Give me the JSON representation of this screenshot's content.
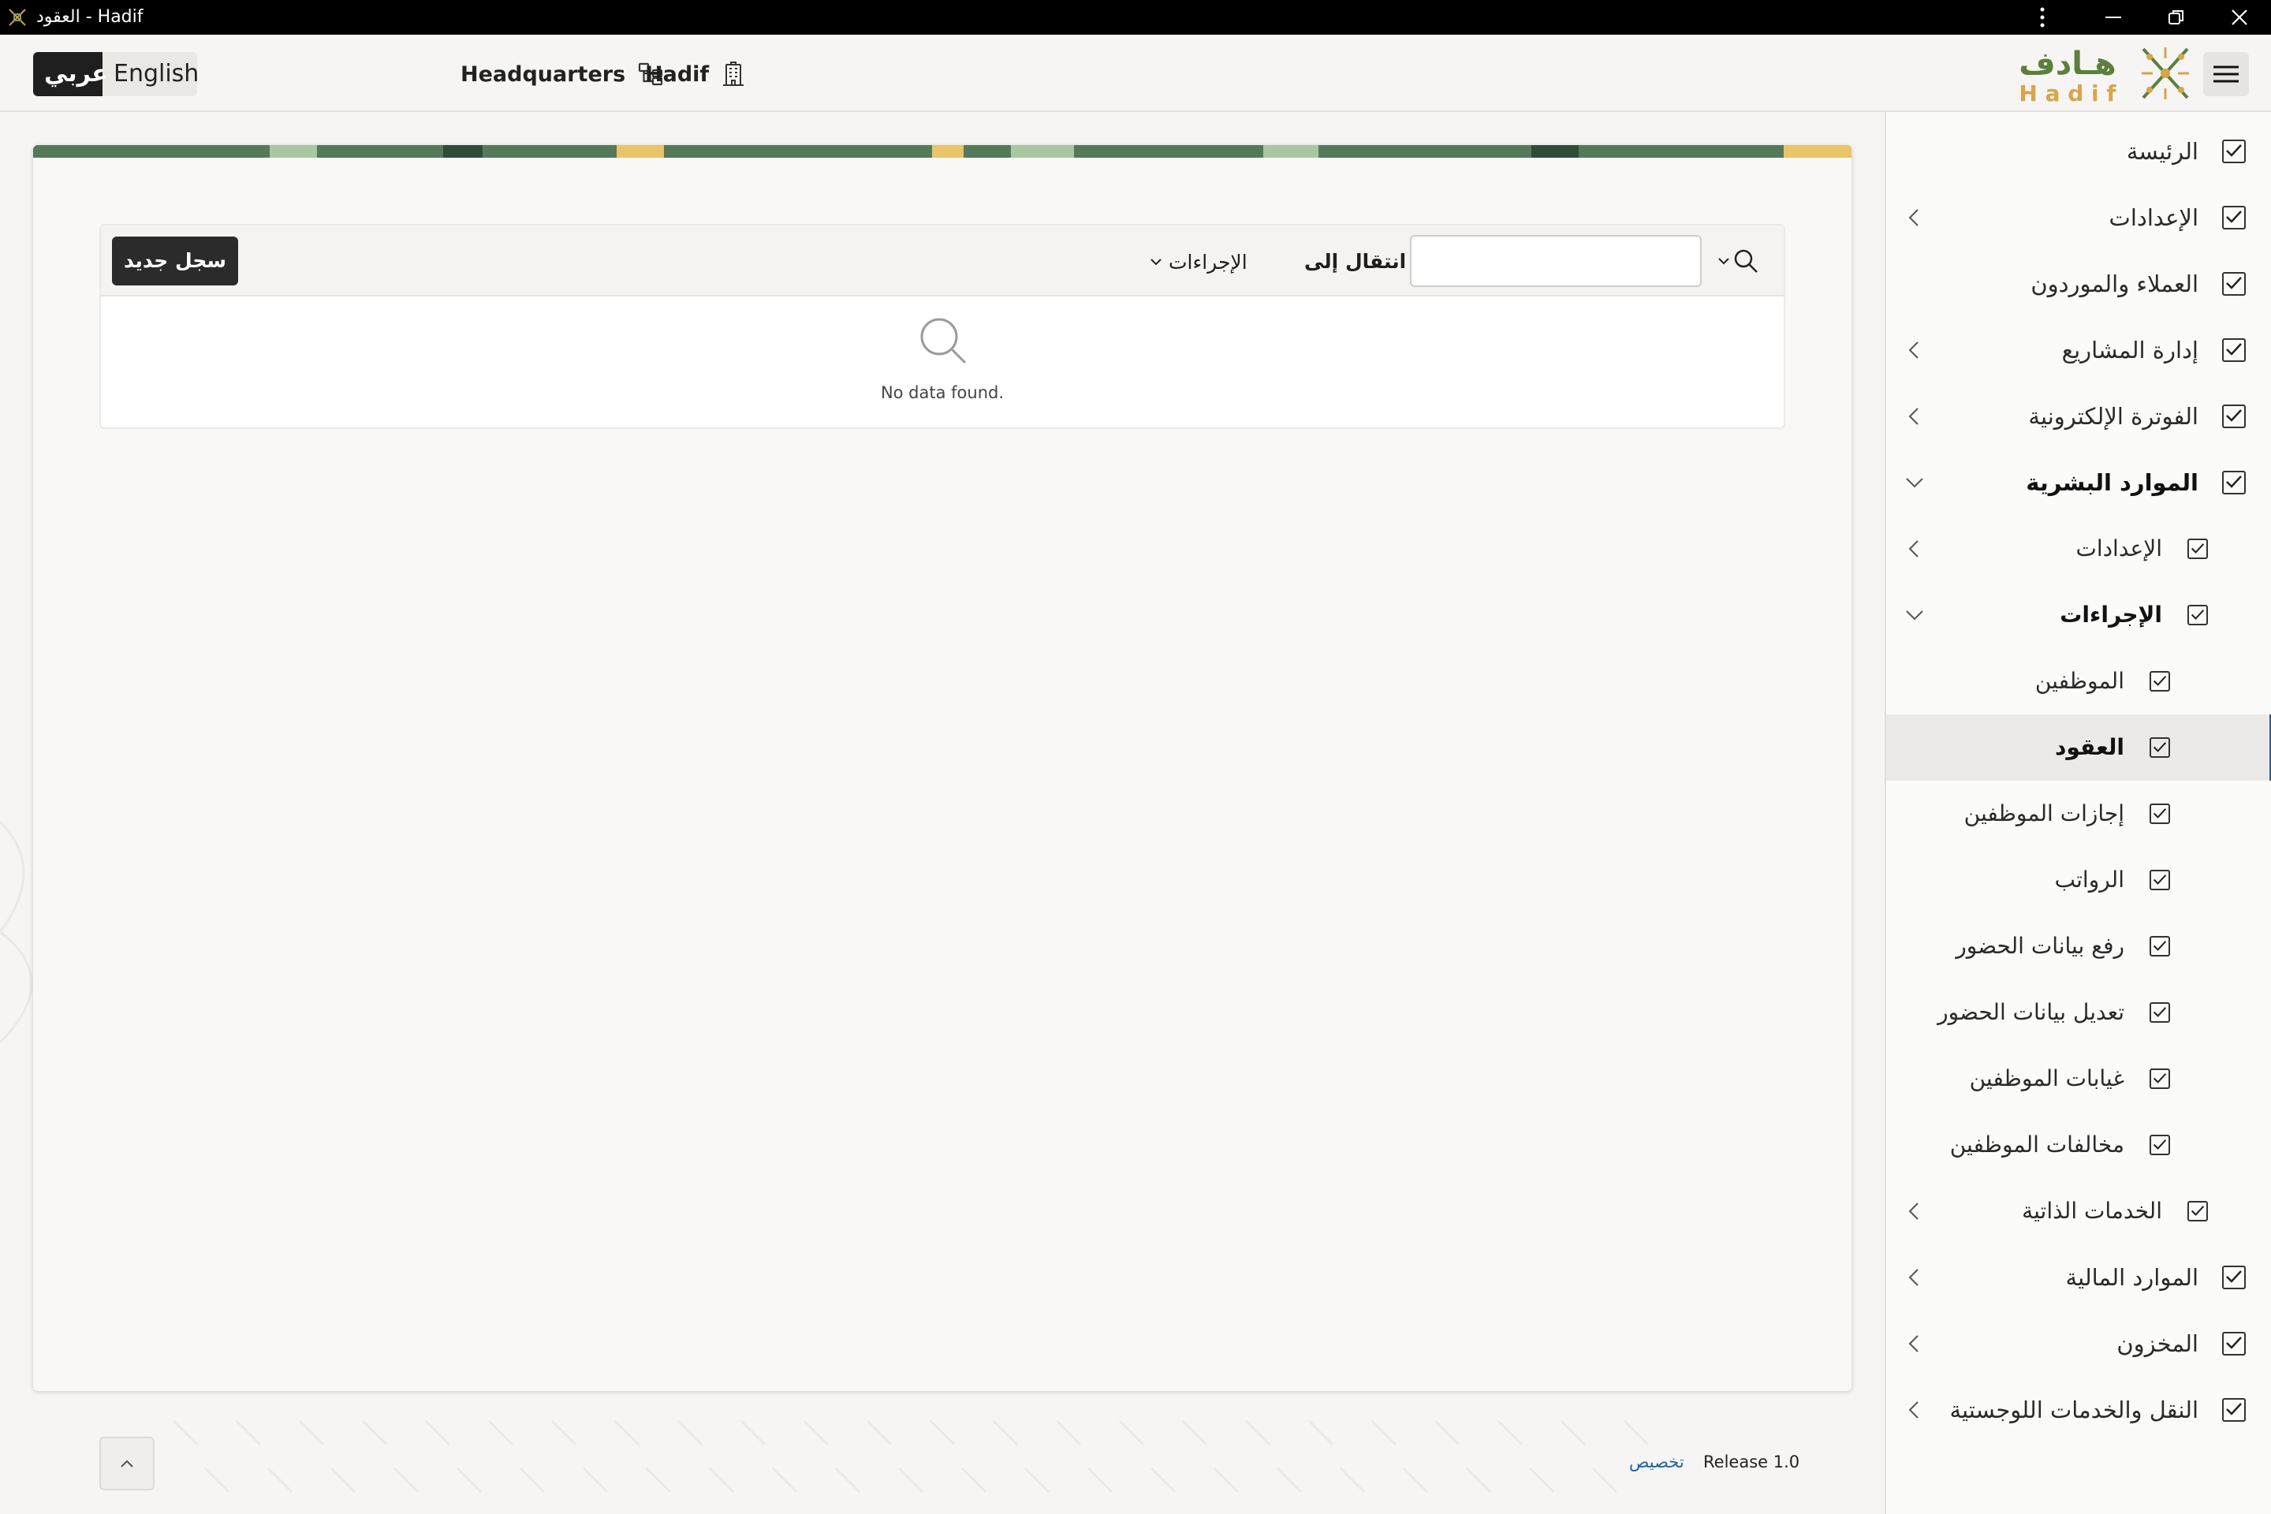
{
  "window": {
    "title": "العقود - Hadif"
  },
  "header": {
    "lang_options": [
      "عربي",
      "English"
    ],
    "active_lang": "عربي",
    "headquarters_label": "Headquarters",
    "company_label": "Hadif",
    "logo_arabic": "هـادف",
    "logo_latin": "H a d i f"
  },
  "sidebar": {
    "items": [
      {
        "label": "الرئيسة",
        "level": 0,
        "chevron": "none"
      },
      {
        "label": "الإعدادات",
        "level": 0,
        "chevron": "left"
      },
      {
        "label": "العملاء والموردون",
        "level": 0,
        "chevron": "none"
      },
      {
        "label": "إدارة المشاريع",
        "level": 0,
        "chevron": "left"
      },
      {
        "label": "الفوترة الإلكترونية",
        "level": 0,
        "chevron": "left"
      },
      {
        "label": "الموارد البشرية",
        "level": 0,
        "chevron": "down",
        "bold": true
      },
      {
        "label": "الإعدادات",
        "level": 1,
        "chevron": "left"
      },
      {
        "label": "الإجراءات",
        "level": 1,
        "chevron": "down",
        "bold": true
      },
      {
        "label": "الموظفين",
        "level": 2,
        "chevron": "none"
      },
      {
        "label": "العقود",
        "level": 2,
        "chevron": "none",
        "bold": true,
        "selected": true
      },
      {
        "label": "إجازات الموظفين",
        "level": 2,
        "chevron": "none"
      },
      {
        "label": "الرواتب",
        "level": 2,
        "chevron": "none"
      },
      {
        "label": "رفع بيانات الحضور",
        "level": 2,
        "chevron": "none"
      },
      {
        "label": "تعديل بيانات الحضور",
        "level": 2,
        "chevron": "none"
      },
      {
        "label": "غيابات الموظفين",
        "level": 2,
        "chevron": "none"
      },
      {
        "label": "مخالفات الموظفين",
        "level": 2,
        "chevron": "none"
      },
      {
        "label": "الخدمات الذاتية",
        "level": 1,
        "chevron": "left"
      },
      {
        "label": "الموارد المالية",
        "level": 0,
        "chevron": "left"
      },
      {
        "label": "المخزون",
        "level": 0,
        "chevron": "left"
      },
      {
        "label": "النقل والخدمات اللوجستية",
        "level": 0,
        "chevron": "left"
      }
    ]
  },
  "report": {
    "new_button_label": "سجل جديد",
    "actions_label": "الإجراءات",
    "goto_label": "انتقال إلى",
    "search_value": "",
    "search_placeholder": "",
    "no_data_message": "No data found."
  },
  "footer": {
    "release_label": "Release 1.0",
    "customize_link": "تخصيص"
  },
  "colors": {
    "accent_dark": "#2b2b2b",
    "link_blue": "#1d64a8",
    "selected_indicator": "#3a5a78",
    "logo_green": "#5d7f3e",
    "logo_gold": "#d7a54a"
  }
}
